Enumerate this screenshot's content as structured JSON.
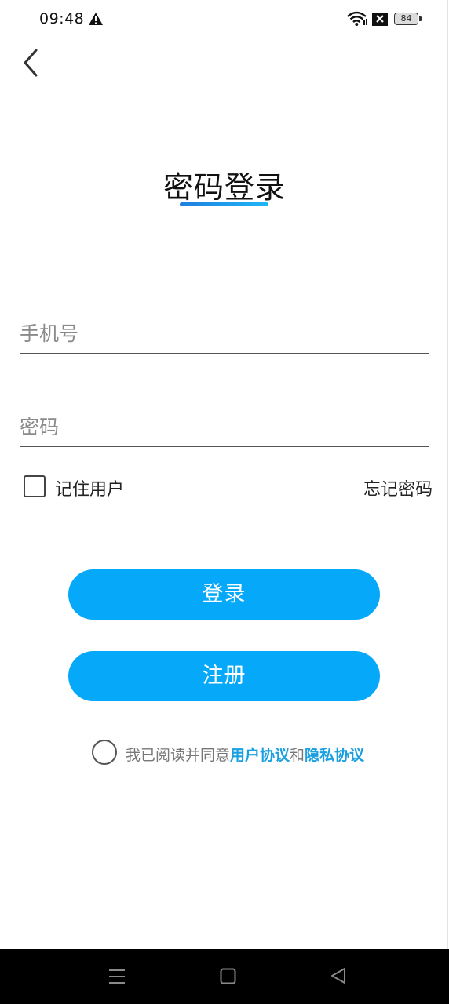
{
  "status_bar": {
    "time": "09:48",
    "battery_level": "84",
    "icons": [
      "warning-icon",
      "wifi-icon",
      "sim-blocked-icon",
      "battery-icon"
    ]
  },
  "header": {
    "back_icon": "chevron-left-icon",
    "title": "密码登录"
  },
  "form": {
    "phone_placeholder": "手机号",
    "phone_value": "",
    "password_placeholder": "密码",
    "password_value": "",
    "remember_label": "记住用户",
    "remember_checked": false,
    "forgot_label": "忘记密码"
  },
  "buttons": {
    "login_label": "登录",
    "register_label": "注册"
  },
  "agreement": {
    "checked": false,
    "prefix": "我已阅读并同意",
    "user_agreement": "用户协议",
    "conjunction": "和",
    "privacy_agreement": "隐私协议"
  },
  "nav_bar": {
    "icons": [
      "menu-icon",
      "home-icon",
      "back-triangle-icon"
    ]
  },
  "colors": {
    "accent": "#06a9f9",
    "link": "#1a9fe0",
    "title_underline_start": "#1e7fe0",
    "title_underline_end": "#1fb6f5",
    "nav_background": "#000000"
  }
}
